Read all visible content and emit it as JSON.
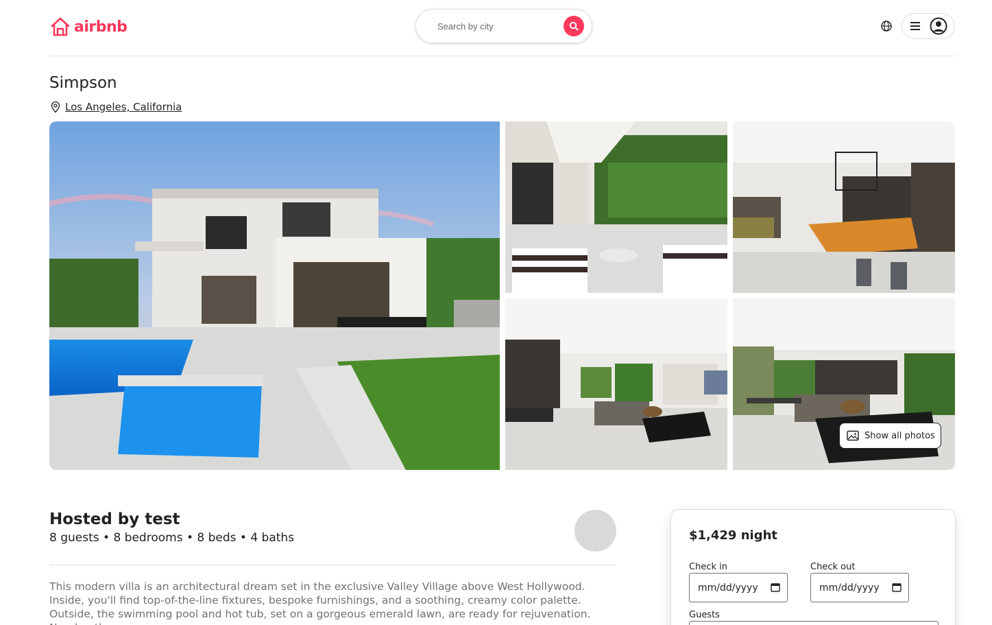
{
  "brand": {
    "name": "airbnb",
    "color": "#ff385c"
  },
  "search": {
    "placeholder": "Search by city"
  },
  "header": {
    "icons": [
      "search-icon",
      "globe-icon",
      "menu-icon",
      "user-icon"
    ]
  },
  "listing": {
    "title": "Simpson",
    "location": "Los Angeles, California",
    "show_all_photos": "Show all photos"
  },
  "host": {
    "title": "Hosted by test",
    "stats": "8 guests • 8 bedrooms • 8 beds • 4 baths",
    "description": "This modern villa is an architectural dream set in the exclusive Valley Village above West Hollywood. Inside, you'll find top-of-the-line fixtures, bespoke furnishings, and a soothing, creamy color palette. Outside, the swimming pool and hot tub, set on a gorgeous emerald lawn, are ready for rejuvenation. Nearby, the"
  },
  "booking": {
    "price": "$1,429 night",
    "check_in_label": "Check in",
    "check_out_label": "Check out",
    "date_placeholder": "mm/dd/yyyy",
    "guests_label": "Guests"
  }
}
